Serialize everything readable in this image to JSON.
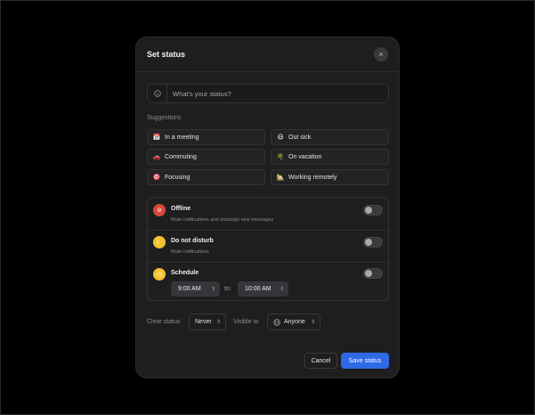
{
  "dialog": {
    "title": "Set status",
    "close_icon": "close-icon",
    "close_glyph": "×"
  },
  "search": {
    "placeholder": "What's your status?",
    "icon": "smiley-icon"
  },
  "suggestions_label": "Suggestions",
  "suggestions": [
    {
      "label": "In a meeting",
      "icon": "calendar-icon",
      "glyph": "📅"
    },
    {
      "label": "Out sick",
      "icon": "sick-face-icon",
      "glyph": "😷"
    },
    {
      "label": "Commuting",
      "icon": "car-icon",
      "glyph": "🚗"
    },
    {
      "label": "On vacation",
      "icon": "palm-tree-icon",
      "glyph": "🌴"
    },
    {
      "label": "Focusing",
      "icon": "target-icon",
      "glyph": "🎯"
    },
    {
      "label": "Working remotely",
      "icon": "house-icon",
      "glyph": "🏡"
    }
  ],
  "options": [
    {
      "title": "Offline",
      "subtitle": "Mute notifications and unassign new messages",
      "icon": "offline-icon",
      "glyph": "⊘",
      "color": "#d9473b",
      "enabled": false
    },
    {
      "title": "Do not disturb",
      "subtitle": "Mute notifications",
      "icon": "moon-icon",
      "glyph": "☾",
      "color": "#f2c230",
      "enabled": false
    },
    {
      "title": "Schedule",
      "subtitle": "",
      "icon": "clock-icon",
      "glyph": "◷",
      "color": "#f2c230",
      "enabled": false
    }
  ],
  "schedule": {
    "from": "9:00 AM",
    "to_label": "to:",
    "to": "10:00 AM"
  },
  "footer": {
    "clear_label": "Clear status",
    "clear_value": "Never",
    "visible_label": "Visible to",
    "visible_value": "Anyone",
    "cancel": "Cancel",
    "save": "Save status"
  },
  "colors": {
    "background": "#000000",
    "modal": "#1e1e1f",
    "accent": "#2f6ae6"
  }
}
